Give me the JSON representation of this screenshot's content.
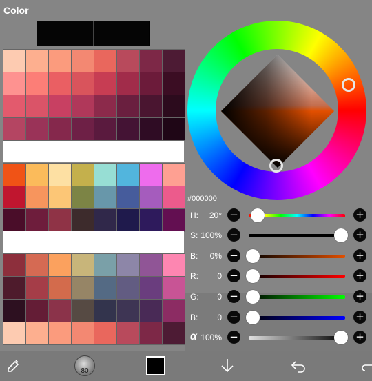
{
  "panel": {
    "title": "Color",
    "hex_value": "#000000",
    "current_color": "#000000",
    "hue_marker_color": "#e24f00"
  },
  "palettes": {
    "block1": [
      [
        "#fdcbb1",
        "#fdaf8f",
        "#fb9b7d",
        "#f38872",
        "#e9675d",
        "#b84a5c",
        "#7d2847",
        "#4d1b34"
      ],
      [
        "#fe9290",
        "#fc7e77",
        "#ea5f63",
        "#d9545c",
        "#c73d53",
        "#a12c4a",
        "#6c1b3a",
        "#3b0d23"
      ],
      [
        "#e35a6d",
        "#da5468",
        "#c84062",
        "#b0385a",
        "#8c2a4b",
        "#6a1f3f",
        "#4a1530",
        "#2c0b1d"
      ],
      [
        "#b44562",
        "#9a3358",
        "#85284c",
        "#6e2046",
        "#5a1a3e",
        "#441334",
        "#2f0c24",
        "#1f0616"
      ]
    ],
    "block2": [
      [
        "#f05316",
        "#fbbb5b",
        "#fde0a3",
        "#c4b04c",
        "#97ded4",
        "#52b5dd",
        "#ee6ced",
        "#fea092"
      ],
      [
        "#c0162f",
        "#f7955d",
        "#fcc676",
        "#7c8445",
        "#6897aa",
        "#465c9c",
        "#a55cbd",
        "#ec5b8c"
      ],
      [
        "#4a0d29",
        "#6e1d3c",
        "#8f3346",
        "#3d2b2c",
        "#30284a",
        "#1f1a4c",
        "#2e1a5c",
        "#630f51"
      ]
    ],
    "block3": [
      [
        "#8d2f3c",
        "#d56a53",
        "#fba15e",
        "#c8b57a",
        "#7aa0a8",
        "#8d86a8",
        "#905596",
        "#fd86b1"
      ],
      [
        "#4e1b2c",
        "#a53d48",
        "#d36b4c",
        "#968566",
        "#546a84",
        "#625c82",
        "#6a3d7e",
        "#c85495"
      ],
      [
        "#2d1020",
        "#641d36",
        "#8b334a",
        "#564a43",
        "#33344d",
        "#3e3554",
        "#492a56",
        "#8c2c63"
      ]
    ],
    "history": [
      "#fdcbb1",
      "#fdaf8f",
      "#fb9b7d",
      "#f38872",
      "#e9675d",
      "#b84a5c",
      "#7d2847",
      "#4d1b34"
    ]
  },
  "sliders": [
    {
      "id": "hue",
      "label": "H:",
      "value": "20°",
      "fraction": 0.055
    },
    {
      "id": "saturation",
      "label": "S:",
      "value": "100%",
      "fraction": 1.0
    },
    {
      "id": "brightness",
      "label": "B:",
      "value": "0%",
      "fraction": 0.0
    },
    {
      "id": "red",
      "label": "R:",
      "value": "0",
      "fraction": 0.0
    },
    {
      "id": "green",
      "label": "G:",
      "value": "0",
      "fraction": 0.0
    },
    {
      "id": "blue",
      "label": "B:",
      "value": "0",
      "fraction": 0.0
    },
    {
      "id": "alpha",
      "label": "α",
      "value": "100%",
      "fraction": 1.0
    }
  ],
  "buttons": {
    "minus": "−",
    "plus": "+"
  },
  "toolbar": {
    "brush_size": "80",
    "color": "#000000",
    "icons": [
      "swap-tool-icon",
      "brush-icon",
      "color-chip",
      "download-icon",
      "undo-icon",
      "redo-icon"
    ]
  }
}
